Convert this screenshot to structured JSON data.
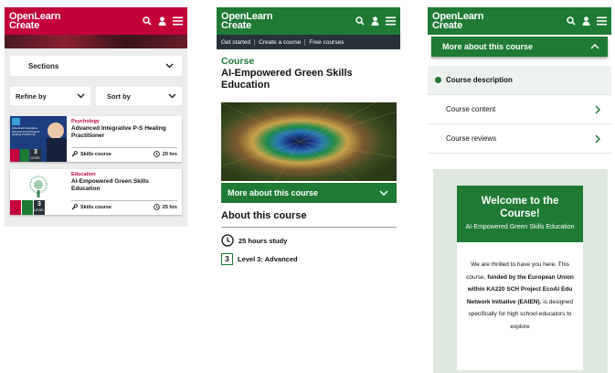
{
  "brand": {
    "logo_line1": "OpenLearn",
    "logo_line2": "Create"
  },
  "panel1": {
    "sections_label": "Sections",
    "refine_label": "Refine by",
    "sort_label": "Sort by",
    "cards": [
      {
        "category": "Psychology",
        "category_color": "#c3003a",
        "title": "Advanced Integrative P-S Healing Practitioner",
        "thumb_text": "Advanced Integrative Spiritual-Psychological Healing Practitioner",
        "type": "Skills course",
        "hours": "20 hrs",
        "level_num": "3",
        "level_word": "LEVEL"
      },
      {
        "category": "Education",
        "category_color": "#c3003a",
        "title": "AI-Empowered Green Skills Education",
        "type": "Skills course",
        "hours": "25 hrs",
        "level_num": "3",
        "level_word": "LEVEL"
      }
    ]
  },
  "panel2": {
    "nav": [
      "Get started",
      "Create a course",
      "Free courses"
    ],
    "course_label": "Course",
    "course_title": "AI-Empowered Green Skills Education",
    "more_label": "More about this course",
    "about_title": "About this course",
    "study_hours": "25 hours study",
    "level_num": "3",
    "level_text": "Level 3: Advanced"
  },
  "panel3": {
    "more_label": "More about this course",
    "items": [
      "Course description",
      "Course content",
      "Course reviews"
    ],
    "welcome_title": "Welcome to the Course!",
    "welcome_sub": "AI-Empowered Green Skills Education",
    "text_a": "We are thrilled to have you here. This course, ",
    "text_bold": "funded by the European Union within KA220 SCH Project EcoAI Edu Network Initiative (EAIEN)",
    "text_b": ", is designed specifically for high school educators to explore"
  },
  "colors": {
    "red": "#c3003a",
    "green": "#1e7a35",
    "nav_dark": "#263238"
  },
  "icons": [
    "search-icon",
    "user-icon",
    "menu-icon",
    "chevron-down-icon",
    "chevron-up-icon",
    "chevron-right-icon",
    "wrench-icon",
    "clock-icon"
  ]
}
